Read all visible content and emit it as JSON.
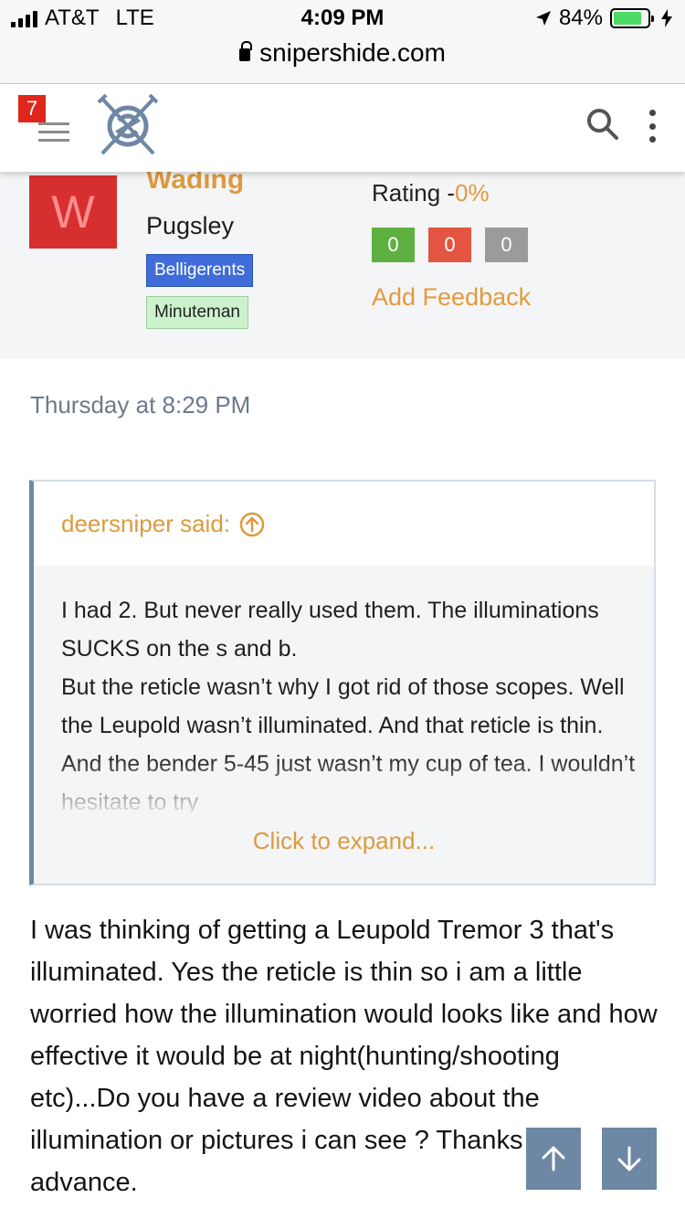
{
  "status_bar": {
    "carrier": "AT&T",
    "network": "LTE",
    "time": "4:09 PM",
    "battery_percent": "84%",
    "battery_level": 0.84,
    "location_icon": "location-arrow-icon",
    "charging_icon": "bolt-icon"
  },
  "browser": {
    "url": "snipershide.com"
  },
  "header": {
    "notification_count": "7",
    "menu_icon": "hamburger-icon",
    "logo_icon": "crossed-sabers-logo",
    "search_icon": "search-icon",
    "more_icon": "kebab-menu-icon"
  },
  "user": {
    "avatar_letter": "W",
    "username": "Wading",
    "title": "Pugsley",
    "banners": [
      "Belligerents",
      "Minuteman"
    ],
    "rating_label": "Rating -",
    "rating_value": "0%",
    "feedback": {
      "positive": "0",
      "negative": "0",
      "neutral": "0"
    },
    "add_feedback": "Add Feedback"
  },
  "post": {
    "date": "Thursday at 8:29 PM",
    "quote": {
      "author": "deersniper said:",
      "text": "I had 2. But never really used them. The illuminations SUCKS on the s and b.\nBut the reticle wasn’t why I got rid of those scopes. Well the Leupold wasn’t illuminated. And that reticle is thin. And the bender 5-45 just wasn’t my cup of tea. I wouldn’t hesitate to try",
      "expand_label": "Click to expand..."
    },
    "body": "I was thinking of getting a Leupold Tremor 3 that's illuminated. Yes the reticle is thin so i am a little worried how the illumination would looks like and how effective it would be at night(hunting/shooting etc)...Do you have a review video about the illumination or pictures i can see ? Thanks in advance."
  },
  "colors": {
    "accent": "#dd9a3e",
    "avatar": "#d72f2f",
    "nav_button": "#6d87a4",
    "badge": "#e0261b"
  }
}
